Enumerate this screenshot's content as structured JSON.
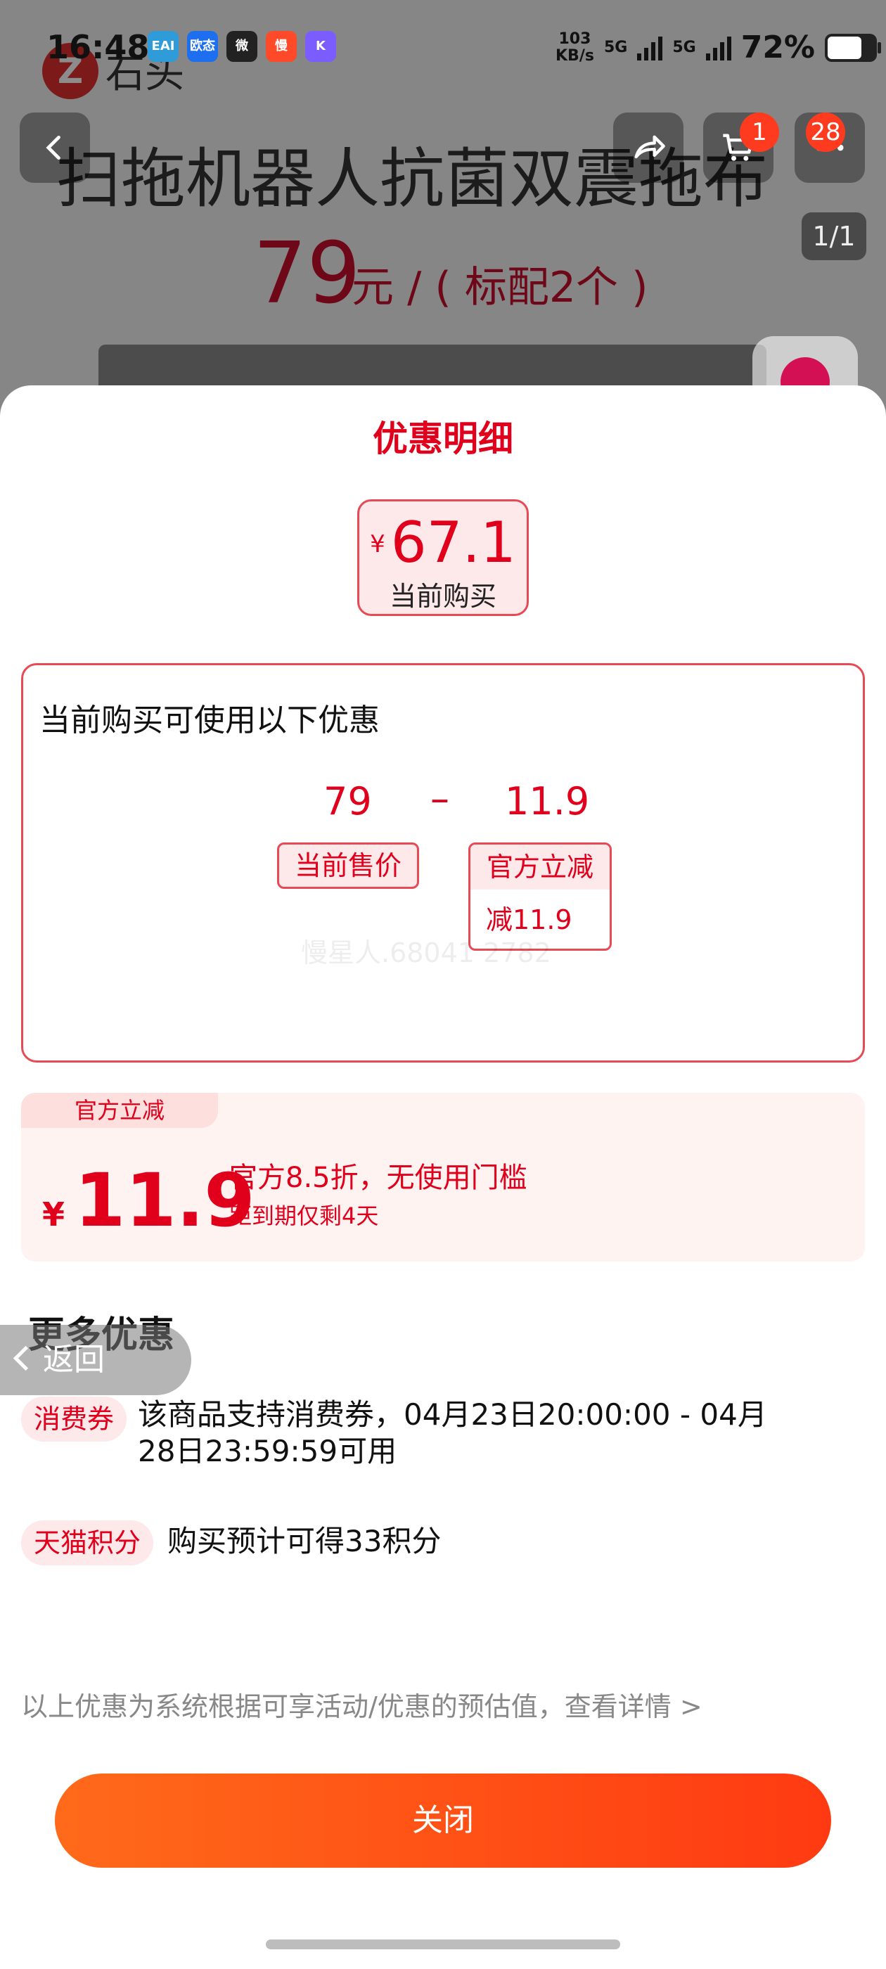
{
  "statusbar": {
    "time": "16:48",
    "apps": [
      "EAI",
      "欧态",
      "微",
      "慢",
      "K"
    ],
    "net_speed_value": "103",
    "net_speed_unit": "KB/s",
    "sim1": "5G",
    "sim2": "5G",
    "battery_pct": "72%",
    "battery_level": 0.72
  },
  "background_page": {
    "brand_name": "石头",
    "product_title": "扫拖机器人抗菌双震拖布",
    "price": "79",
    "price_unit": "元 / ( 标配2个 )",
    "cart_badge": "1",
    "message_badge": "28",
    "image_counter": "1/1"
  },
  "sheet": {
    "title": "优惠明细",
    "current": {
      "currency": "¥",
      "price": "67.1",
      "label": "当前购买"
    },
    "detail": {
      "heading": "当前购买可使用以下优惠",
      "base_value": "79",
      "operator": "–",
      "discount_value": "11.9",
      "base_tag": "当前售价",
      "discount_tag": "官方立减",
      "discount_sub": "减11.9",
      "watermark": "慢星人.68041 2782"
    },
    "promo": {
      "tab": "官方立减",
      "currency": "¥",
      "amount": "11.9",
      "desc": "官方8.5折，无使用门槛",
      "sub": "距到期仅剩4天"
    },
    "more": {
      "title": "更多优惠",
      "back_label": "返回",
      "items": [
        {
          "tag": "消费券",
          "text": "该商品支持消费券，04月23日20:00:00 - 04月28日23:59:59可用"
        },
        {
          "tag": "天猫积分",
          "text": "购买预计可得33积分"
        }
      ]
    },
    "footnote": "以上优惠为系统根据可享活动/优惠的预估值，查看详情 >",
    "close_label": "关闭"
  },
  "colors": {
    "accent_red": "#e0001b",
    "button_gradient_start": "#ff6a1a",
    "button_gradient_end": "#ff3a12"
  }
}
